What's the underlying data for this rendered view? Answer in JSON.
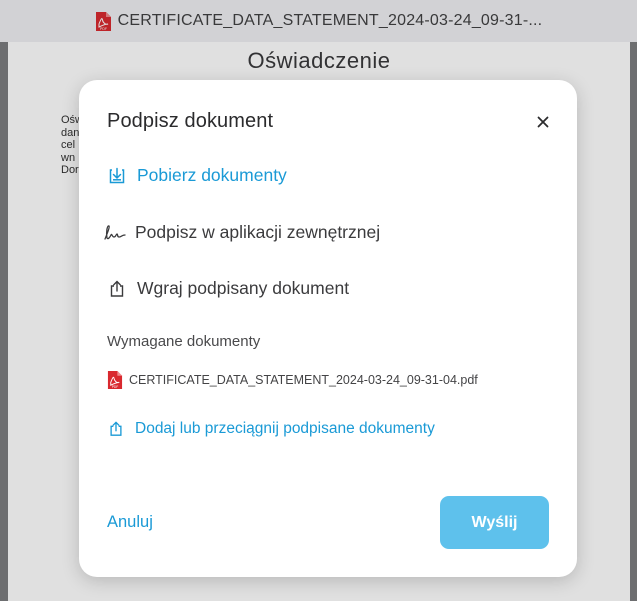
{
  "viewer": {
    "file_title": "CERTIFICATE_DATA_STATEMENT_2024-03-24_09-31-...",
    "document_heading": "Oświadczenie",
    "body_lines": [
      "Ośw",
      "dan",
      "cel",
      "wn",
      "Dor"
    ]
  },
  "modal": {
    "title": "Podpisz dokument",
    "close_label": "×",
    "actions": {
      "download": "Pobierz dokumenty",
      "external_sign": "Podpisz w aplikacji zewnętrznej",
      "upload_signed": "Wgraj podpisany dokument"
    },
    "required_section_label": "Wymagane dokumenty",
    "required_files": [
      "CERTIFICATE_DATA_STATEMENT_2024-03-24_09-31-04.pdf"
    ],
    "add_documents_label": "Dodaj lub przeciągnij podpisane dokumenty",
    "cancel_label": "Anuluj",
    "send_label": "Wyślij"
  },
  "colors": {
    "accent": "#1a9ad6",
    "send_button": "#5ec1ec",
    "pdf_red": "#d9292f",
    "backdrop": "#7d7e80"
  },
  "icons": {
    "pdf": "pdf-file-icon",
    "download": "download-icon",
    "signature": "signature-icon",
    "upload": "upload-icon",
    "close": "close-icon"
  }
}
